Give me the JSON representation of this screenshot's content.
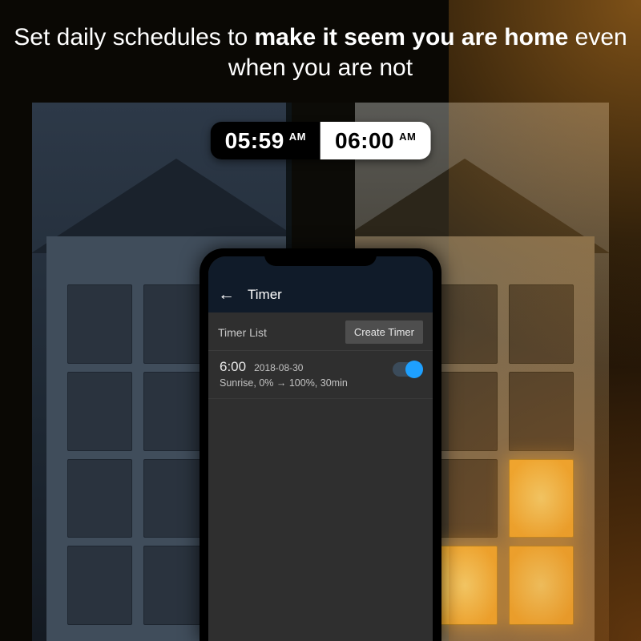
{
  "headline": {
    "prefix": "Set daily schedules to ",
    "bold": "make it seem you are home",
    "suffix": " even when you are not"
  },
  "time_overlay": {
    "dark": {
      "time": "05:59",
      "ampm": "AM"
    },
    "light": {
      "time": "06:00",
      "ampm": "AM"
    }
  },
  "app": {
    "title": "Timer",
    "section_label": "Timer List",
    "create_button": "Create Timer",
    "timers": [
      {
        "time": "6:00",
        "date": "2018-08-30",
        "description": "Sunrise, 0% → 100%, 30min",
        "enabled": true
      }
    ]
  },
  "colors": {
    "accent": "#1ea0ff",
    "appbar": "#101b29",
    "screen": "#2f2f2f"
  }
}
